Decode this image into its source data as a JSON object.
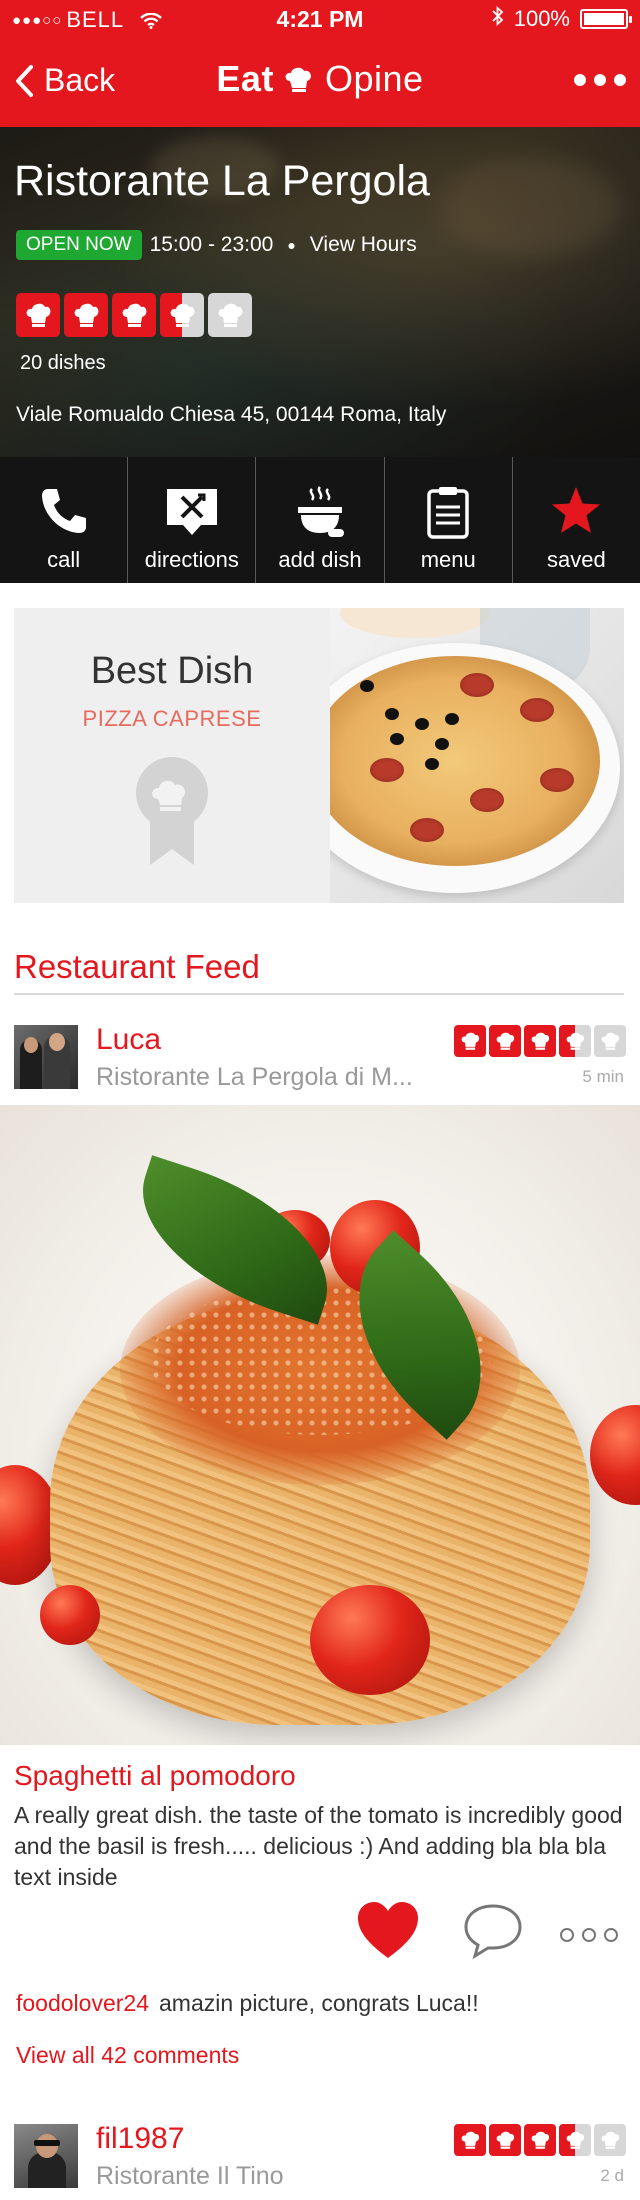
{
  "status_bar": {
    "carrier": "BELL",
    "time": "4:21 PM",
    "battery": "100%"
  },
  "nav": {
    "back_label": "Back",
    "logo_part1": "Eat",
    "logo_part2": "Opine"
  },
  "restaurant": {
    "name": "Ristorante La Pergola",
    "open_badge": "OPEN NOW",
    "hours": "15:00 - 23:00",
    "view_hours": "View Hours",
    "rating_hats": 3.5,
    "dish_count": "20 dishes",
    "address": "Viale Romualdo Chiesa 45, 00144 Roma, Italy"
  },
  "actions": [
    {
      "label": "call",
      "icon": "phone-icon"
    },
    {
      "label": "directions",
      "icon": "directions-icon"
    },
    {
      "label": "add dish",
      "icon": "add-dish-icon"
    },
    {
      "label": "menu",
      "icon": "menu-icon"
    },
    {
      "label": "saved",
      "icon": "star-icon"
    }
  ],
  "best_dish": {
    "heading": "Best Dish",
    "name": "PIZZA CAPRESE"
  },
  "feed": {
    "title": "Restaurant Feed",
    "posts": [
      {
        "user": "Luca",
        "venue": "Ristorante La Pergola di M...",
        "time_ago": "5 min",
        "rating_hats": 3.5,
        "dish": "Spaghetti al pomodoro",
        "text": "A really great dish. the taste of the tomato is incredibly good and the basil is fresh..... delicious :) And adding bla bla bla text inside",
        "comment_user": "foodolover24",
        "comment_text": "amazin picture, congrats Luca!!",
        "view_all_comments": "View all 42 comments"
      },
      {
        "user": "fil1987",
        "venue": "Ristorante Il Tino",
        "time_ago": "2 d",
        "rating_hats": 3.5
      }
    ]
  },
  "colors": {
    "brand_red": "#e3171d",
    "open_green": "#1fa831",
    "accent_pink": "#e86a5e"
  }
}
